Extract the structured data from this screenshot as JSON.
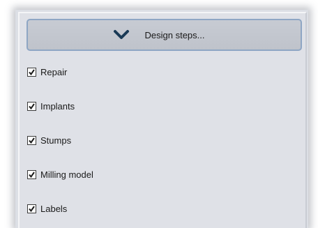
{
  "header": {
    "label": "Design steps...",
    "icon": "chevron-down-icon"
  },
  "options": [
    {
      "label": "Repair",
      "checked": true
    },
    {
      "label": "Implants",
      "checked": true
    },
    {
      "label": "Stumps",
      "checked": true
    },
    {
      "label": "Milling model",
      "checked": true
    },
    {
      "label": "Labels",
      "checked": true
    }
  ],
  "colors": {
    "panel_bg": "#dfe1e7",
    "button_border": "#8ea6c4",
    "chevron": "#1a3a56"
  }
}
